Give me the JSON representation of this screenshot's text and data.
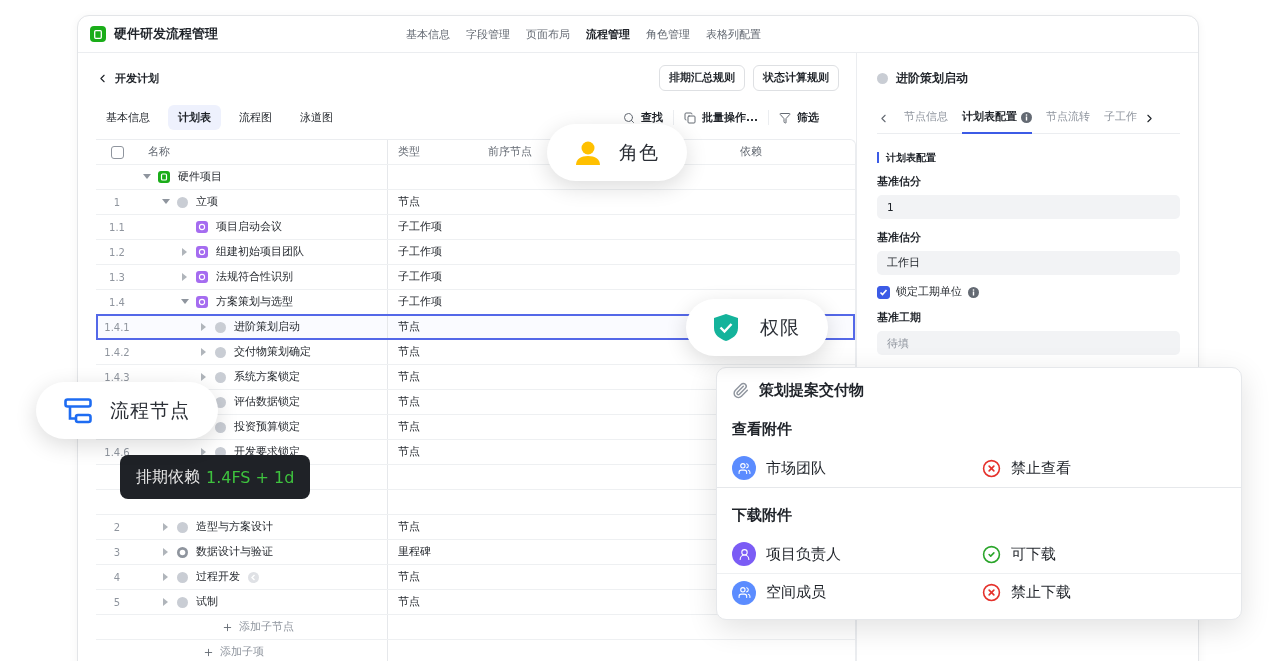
{
  "app": {
    "title": "硬件研发流程管理"
  },
  "nav": [
    {
      "label": "基本信息",
      "selected": false
    },
    {
      "label": "字段管理",
      "selected": false
    },
    {
      "label": "页面布局",
      "selected": false
    },
    {
      "label": "流程管理",
      "selected": true
    },
    {
      "label": "角色管理",
      "selected": false
    },
    {
      "label": "表格列配置",
      "selected": false
    }
  ],
  "page": {
    "back_label": "开发计划",
    "actions": [
      "排期汇总规则",
      "状态计算规则"
    ]
  },
  "view_tabs": [
    {
      "label": "基本信息",
      "selected": false
    },
    {
      "label": "计划表",
      "selected": true
    },
    {
      "label": "流程图",
      "selected": false
    },
    {
      "label": "泳道图",
      "selected": false
    }
  ],
  "toolbar": [
    {
      "kind": "search",
      "label": "查找"
    },
    {
      "kind": "batch",
      "label": "批量操作..."
    },
    {
      "kind": "filter",
      "label": "筛选"
    }
  ],
  "table": {
    "select_all": {
      "checked": false
    },
    "columns": [
      "名称",
      "类型",
      "前序节点",
      "依赖"
    ],
    "rows": [
      {
        "kind": "project",
        "name": "硬件项目",
        "expanded": true,
        "selected": false,
        "children": [
          {
            "kind": "node",
            "num": "1",
            "name": "立项",
            "type": "节点",
            "expanded": true,
            "selected": false,
            "rollback": false,
            "children": [
              {
                "kind": "task",
                "num": "1.1",
                "name": "项目启动会议",
                "type": "子工作项",
                "selected": false
              },
              {
                "kind": "task",
                "num": "1.2",
                "name": "组建初始项目团队",
                "type": "子工作项",
                "expanded": false,
                "selected": false
              },
              {
                "kind": "task",
                "num": "1.3",
                "name": "法规符合性识别",
                "type": "子工作项",
                "expanded": false,
                "selected": false
              },
              {
                "kind": "task",
                "num": "1.4",
                "name": "方案策划与选型",
                "type": "子工作项",
                "expanded": true,
                "selected": false,
                "children": [
                  {
                    "kind": "node",
                    "num": "1.4.1",
                    "name": "进阶策划启动",
                    "type": "节点",
                    "expanded": false,
                    "selected": true
                  },
                  {
                    "kind": "node",
                    "num": "1.4.2",
                    "name": "交付物策划确定",
                    "type": "节点",
                    "expanded": false,
                    "selected": false
                  },
                  {
                    "kind": "node",
                    "num": "1.4.3",
                    "name": "系统方案锁定",
                    "type": "节点",
                    "expanded": false,
                    "selected": false
                  },
                  {
                    "kind": "node",
                    "name": "评估数据锁定",
                    "type": "节点",
                    "selected": false
                  },
                  {
                    "kind": "node",
                    "name": "投资预算锁定",
                    "type": "节点",
                    "selected": false
                  },
                  {
                    "kind": "node",
                    "num": "1.4.6",
                    "name": "开发要求锁定",
                    "type": "节点",
                    "expanded": false,
                    "selected": false
                  },
                  {
                    "kind": "blank"
                  },
                  {
                    "kind": "blank"
                  }
                ]
              }
            ]
          },
          {
            "kind": "node",
            "num": "2",
            "name": "造型与方案设计",
            "type": "节点",
            "expanded": false,
            "selected": false,
            "rollback": false
          },
          {
            "kind": "milestone",
            "num": "3",
            "name": "数据设计与验证",
            "type": "里程碑",
            "expanded": false,
            "selected": false,
            "rollback": false
          },
          {
            "kind": "node",
            "num": "4",
            "name": "过程开发",
            "type": "节点",
            "expanded": false,
            "selected": false,
            "rollback": true
          },
          {
            "kind": "node",
            "num": "5",
            "name": "试制",
            "type": "节点",
            "expanded": false,
            "selected": false,
            "rollback": false
          },
          {
            "kind": "add",
            "label": "添加子节点"
          }
        ]
      },
      {
        "kind": "add",
        "label": "添加子项"
      }
    ]
  },
  "detail": {
    "title": "进阶策划启动",
    "tabs": [
      {
        "label": "节点信息",
        "selected": false,
        "info": false
      },
      {
        "label": "计划表配置",
        "selected": true,
        "info": true
      },
      {
        "label": "节点流转",
        "selected": false,
        "info": false
      },
      {
        "label": "子工作",
        "selected": false,
        "info": false
      }
    ],
    "section": "计划表配置",
    "fields": [
      {
        "kind": "input",
        "label": "基准估分",
        "value": "1"
      },
      {
        "kind": "input",
        "label": "基准估分",
        "value": "工作日"
      },
      {
        "kind": "checkbox",
        "label": "锁定工期单位",
        "checked": true,
        "info": true
      },
      {
        "kind": "input",
        "label": "基准工期",
        "placeholder": "待填"
      }
    ]
  },
  "badges": [
    {
      "kind": "role",
      "label": "角色"
    },
    {
      "kind": "permission",
      "label": "权限"
    },
    {
      "kind": "flow",
      "label": "流程节点"
    }
  ],
  "tooltip": {
    "label": "排期依赖",
    "value": "1.4FS + 1d"
  },
  "popup": {
    "title": "策划提案交付物",
    "sections": [
      {
        "title": "查看附件",
        "entries": [
          {
            "kind": "team",
            "member": "市场团队",
            "color": "#5b8cff",
            "allowed": false,
            "status": "禁止查看"
          }
        ]
      },
      {
        "title": "下载附件",
        "entries": [
          {
            "kind": "owner",
            "member": "项目负责人",
            "color": "#7b5cf5",
            "allowed": true,
            "status": "可下载"
          },
          {
            "kind": "team",
            "member": "空间成员",
            "color": "#5b8cff",
            "allowed": false,
            "status": "禁止下载"
          }
        ]
      }
    ]
  }
}
